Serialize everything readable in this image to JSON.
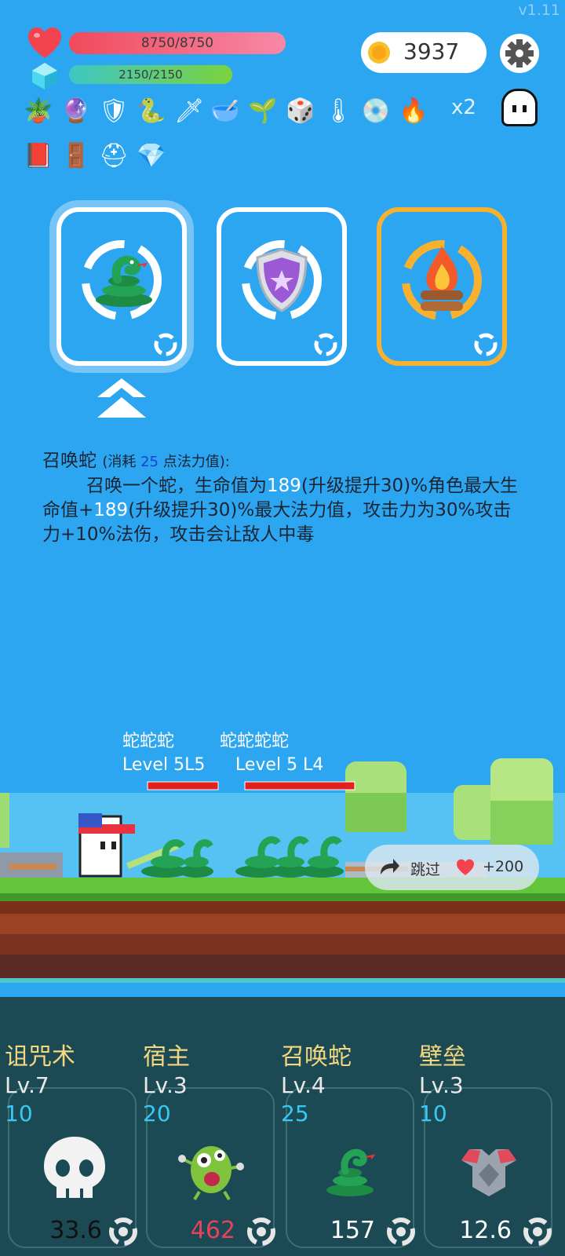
{
  "app": {
    "version": "v1.11"
  },
  "stats": {
    "hp_text": "8750/8750",
    "hp_fraction": 1.0,
    "mp_text": "2150/2150",
    "mp_fraction": 1.0,
    "coins": "3937"
  },
  "items": {
    "row1": [
      "sprout-pot",
      "crystal-ball",
      "shield",
      "snake",
      "sword",
      "mortar",
      "sapling",
      "dice",
      "thermometer",
      "ring",
      "campfire"
    ],
    "multiplier": "x2",
    "row2": [
      "skull-book",
      "door",
      "helmet",
      "diamond"
    ]
  },
  "choices": [
    {
      "name": "snake-card",
      "selected": true
    },
    {
      "name": "shield-card",
      "selected": false
    },
    {
      "name": "campfire-card",
      "selected": false
    }
  ],
  "description": {
    "title": "召唤蛇",
    "cost_prefix": "(消耗 ",
    "cost_value": "25",
    "cost_suffix": " 点法力值):",
    "p1": "召唤一个蛇，生命值为",
    "v1": "189",
    "p2": "(升级提升30)%角色最大生命值+",
    "v2": "189",
    "p3": "(升级提升30)%最大法力值，攻击力为30%攻击力+10%法伤，攻击会让敌人中毒"
  },
  "battle": {
    "name_group1": "蛇蛇蛇",
    "name_group2": "蛇蛇蛇蛇",
    "level_group1": "Level 5L5",
    "level_group2": "Level 5 L4",
    "skip_label": "跳过",
    "skip_reward": "+200"
  },
  "skills": [
    {
      "name": "诅咒术",
      "level": "Lv.7",
      "cost": "10",
      "value": "33.6",
      "value_color": "#111111",
      "icon": "skull"
    },
    {
      "name": "宿主",
      "level": "Lv.3",
      "cost": "20",
      "value": "462",
      "value_color": "#e8415a",
      "icon": "germ"
    },
    {
      "name": "召唤蛇",
      "level": "Lv.4",
      "cost": "25",
      "value": "157",
      "value_color": "#ffffff",
      "icon": "snake"
    },
    {
      "name": "壁垒",
      "level": "Lv.3",
      "cost": "10",
      "value": "12.6",
      "value_color": "#ffffff",
      "icon": "armor"
    }
  ]
}
